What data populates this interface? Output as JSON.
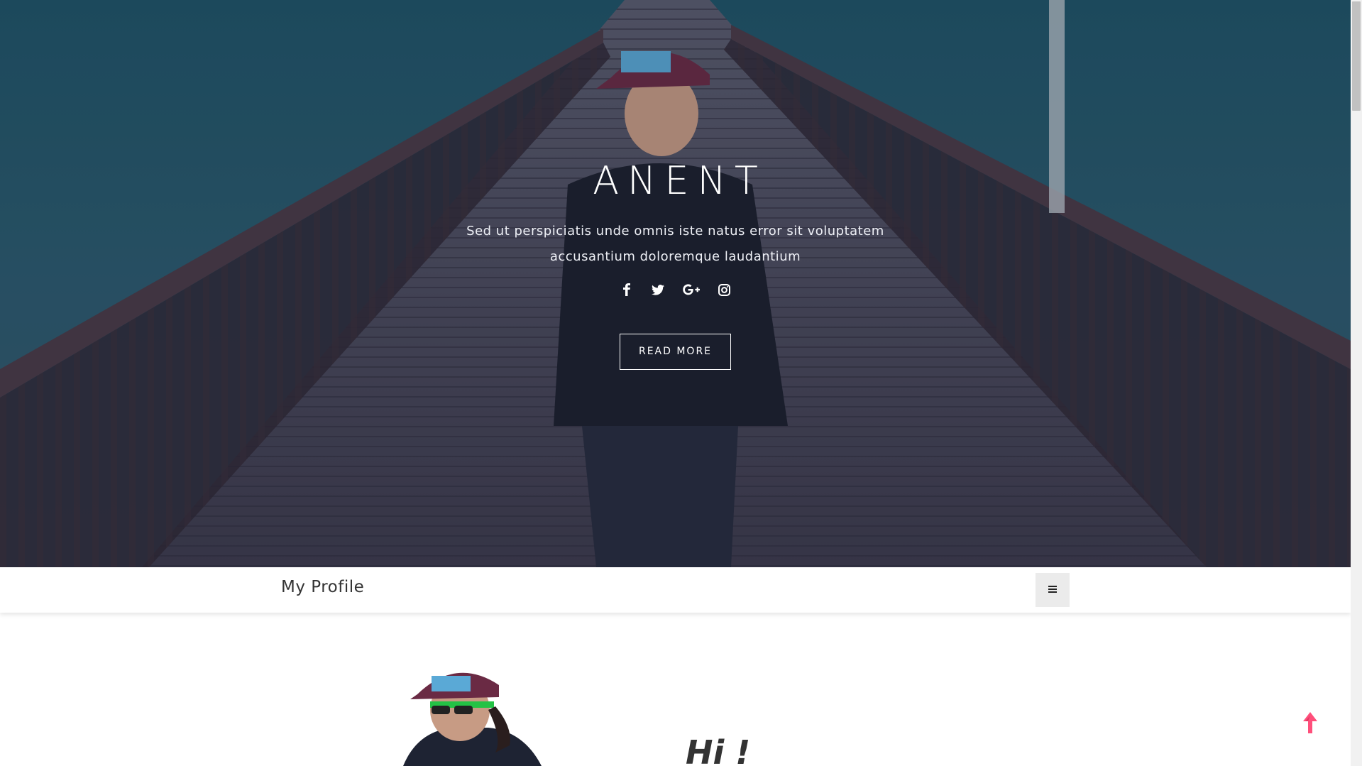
{
  "hero": {
    "title": "ANENT",
    "subtitle": "Sed ut perspiciatis unde omnis iste natus error sit voluptatem accusantium doloremque laudantium",
    "social": [
      {
        "icon": "facebook-icon",
        "glyph": "f"
      },
      {
        "icon": "twitter-icon",
        "glyph": ""
      },
      {
        "icon": "google-plus-icon",
        "glyph": "G+"
      },
      {
        "icon": "instagram-icon",
        "glyph": ""
      }
    ],
    "button_label": "READ MORE"
  },
  "navbar": {
    "brand": "My Profile",
    "menu_icon": "hamburger-menu-icon"
  },
  "about": {
    "greeting": "Hi !"
  },
  "colors": {
    "accent": "#ff4f7b",
    "text_dark": "#333333",
    "hero_overlay": "#2d3a52"
  }
}
